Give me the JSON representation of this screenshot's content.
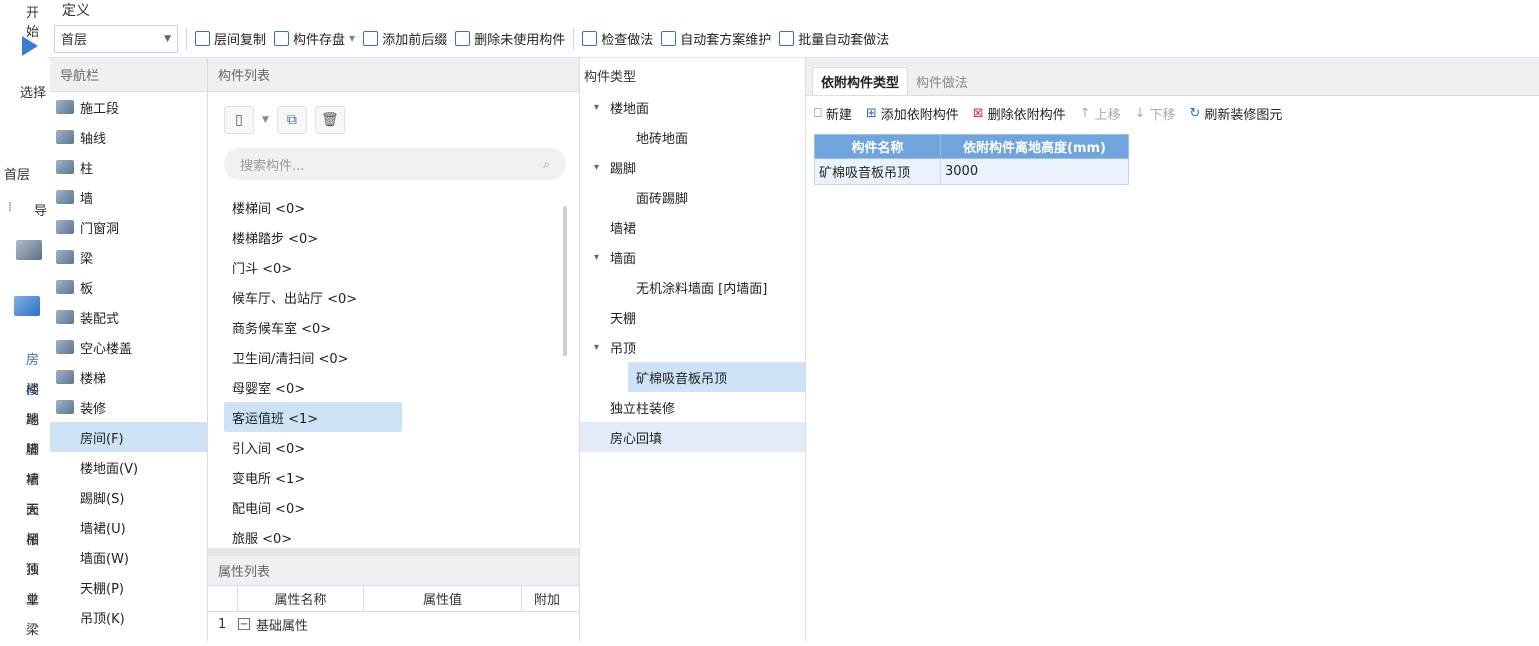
{
  "back": {
    "top_tab": "开始",
    "select_label": "选择",
    "floor_label": "首层",
    "nav_label": "导",
    "side_items": [
      "房间",
      "楼地",
      "踢脚",
      "墙裙",
      "墙面",
      "天棚",
      "吊顶",
      "独立",
      "单梁"
    ]
  },
  "window": {
    "title": "定义"
  },
  "toolbar": {
    "floor": "首层",
    "items": [
      "层间复制",
      "构件存盘",
      "添加前后缀",
      "删除未使用构件",
      "检查做法",
      "自动套方案维护",
      "批量自动套做法"
    ]
  },
  "nav": {
    "header": "导航栏",
    "items": [
      {
        "label": "施工段",
        "icon": "construction-segment-icon"
      },
      {
        "label": "轴线",
        "icon": "grid-axis-icon"
      },
      {
        "label": "柱",
        "icon": "column-icon"
      },
      {
        "label": "墙",
        "icon": "wall-icon"
      },
      {
        "label": "门窗洞",
        "icon": "door-window-icon"
      },
      {
        "label": "梁",
        "icon": "beam-icon"
      },
      {
        "label": "板",
        "icon": "slab-icon"
      },
      {
        "label": "装配式",
        "icon": "prefab-icon"
      },
      {
        "label": "空心楼盖",
        "icon": "hollow-floor-icon"
      },
      {
        "label": "楼梯",
        "icon": "stairs-icon"
      },
      {
        "label": "装修",
        "icon": "decoration-icon"
      }
    ],
    "sub_items": [
      "房间(F)",
      "楼地面(V)",
      "踢脚(S)",
      "墙裙(U)",
      "墙面(W)",
      "天棚(P)",
      "吊顶(K)"
    ]
  },
  "component_list": {
    "header": "构件列表",
    "search_placeholder": "搜索构件...",
    "items": [
      "楼梯间 <0>",
      "楼梯踏步 <0>",
      "门斗 <0>",
      "候车厅、出站厅 <0>",
      "商务候车室 <0>",
      "卫生间/清扫间 <0>",
      "母婴室 <0>",
      "客运值班 <1>",
      "引入间 <0>",
      "变电所 <1>",
      "配电间 <0>",
      "旅服 <0>"
    ],
    "selected_index": 7
  },
  "attributes": {
    "header": "属性列表",
    "columns": [
      "属性名称",
      "属性值",
      "附加"
    ],
    "rows": [
      {
        "num": "1",
        "name": "基础属性"
      }
    ]
  },
  "component_types": {
    "header": "构件类型",
    "items": [
      {
        "label": "楼地面",
        "level": 0,
        "expand": "▾"
      },
      {
        "label": "地砖地面",
        "level": 1,
        "expand": ""
      },
      {
        "label": "踢脚",
        "level": 0,
        "expand": "▾"
      },
      {
        "label": "面砖踢脚",
        "level": 1,
        "expand": ""
      },
      {
        "label": "墙裙",
        "level": 0,
        "expand": ""
      },
      {
        "label": "墙面",
        "level": 0,
        "expand": "▾"
      },
      {
        "label": "无机涂料墙面 [内墙面]",
        "level": 1,
        "expand": ""
      },
      {
        "label": "天棚",
        "level": 0,
        "expand": ""
      },
      {
        "label": "吊顶",
        "level": 0,
        "expand": "▾"
      },
      {
        "label": "矿棉吸音板吊顶",
        "level": 1,
        "expand": ""
      },
      {
        "label": "独立柱装修",
        "level": 0,
        "expand": ""
      },
      {
        "label": "房心回填",
        "level": 0,
        "expand": ""
      }
    ]
  },
  "right": {
    "tabs": [
      "依附构件类型",
      "构件做法"
    ],
    "actions": [
      {
        "label": "新建",
        "disabled": false,
        "icon": "new-icon"
      },
      {
        "label": "添加依附构件",
        "disabled": false,
        "icon": "add-attach-icon"
      },
      {
        "label": "删除依附构件",
        "disabled": false,
        "icon": "delete-attach-icon"
      },
      {
        "label": "上移",
        "disabled": true,
        "icon": "move-up-icon"
      },
      {
        "label": "下移",
        "disabled": true,
        "icon": "move-down-icon"
      },
      {
        "label": "刷新装修图元",
        "disabled": false,
        "icon": "refresh-icon"
      }
    ],
    "table": {
      "columns": [
        "构件名称",
        "依附构件离地高度(mm)"
      ],
      "rows": [
        [
          "矿棉吸音板吊顶",
          "3000"
        ]
      ]
    }
  }
}
